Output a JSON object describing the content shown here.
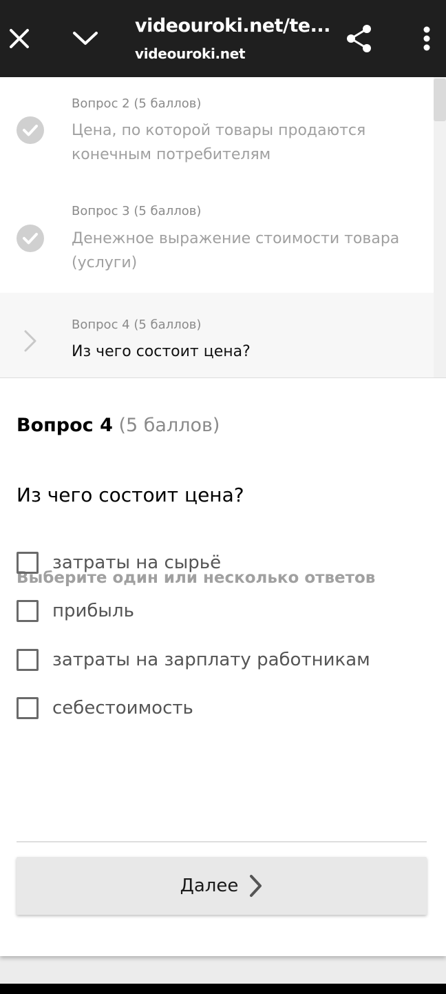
{
  "browser": {
    "url_title": "videouroki.net/te...",
    "domain": "videouroki.net",
    "icons": {
      "close": "close-icon",
      "collapse": "chevron-down-icon",
      "share": "share-icon",
      "more": "more-vertical-icon"
    }
  },
  "question_list": [
    {
      "meta": "Вопрос 2 (5 баллов)",
      "text": "Цена, по которой товары продаются конечным потребителям",
      "status": "done"
    },
    {
      "meta": "Вопрос 3 (5 баллов)",
      "text": "Денежное выражение стоимости товара (услуги)",
      "status": "done"
    },
    {
      "meta": "Вопрос 4 (5 баллов)",
      "text": "Из чего состоит цена?",
      "status": "current"
    }
  ],
  "question": {
    "number_label": "Вопрос 4",
    "points_label": "(5 баллов)",
    "text": "Из чего состоит цена?",
    "hint": "Выберите один или несколько ответов",
    "answers": [
      {
        "label": "затраты на сырьё",
        "checked": false
      },
      {
        "label": "прибыль",
        "checked": false
      },
      {
        "label": "затраты на зарплату работникам",
        "checked": false
      },
      {
        "label": "себестоимость",
        "checked": false
      }
    ]
  },
  "next_button": {
    "label": "Далее"
  },
  "colors": {
    "topbar": "#1f1f1f",
    "done_icon": "#d0d0d0",
    "muted_text": "#a0a0a0"
  }
}
